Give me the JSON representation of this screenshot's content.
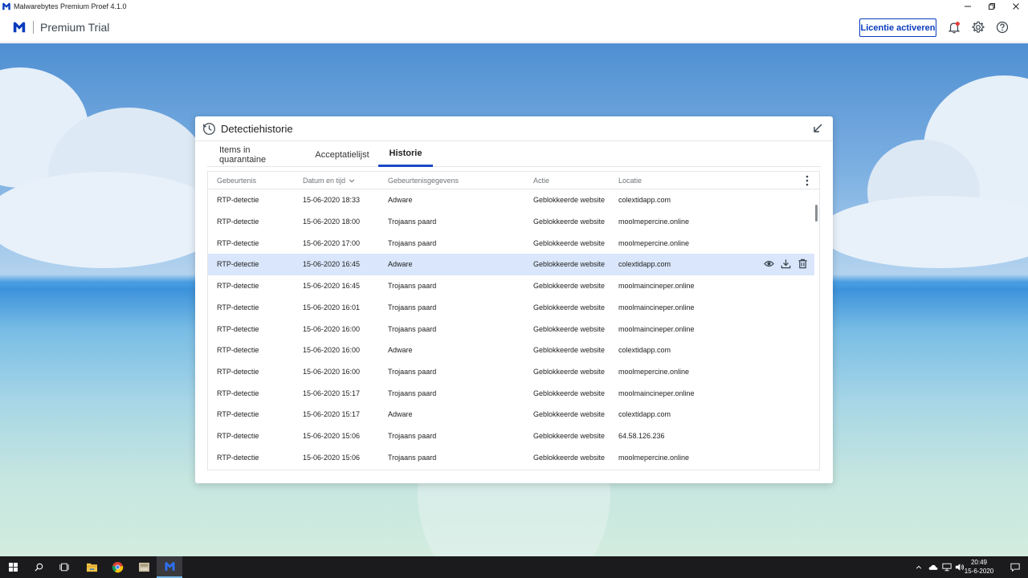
{
  "window": {
    "title": "Malwarebytes Premium Proef  4.1.0",
    "controls": [
      "minimize-icon",
      "restore-icon",
      "close-icon"
    ]
  },
  "header": {
    "product": "Premium Trial",
    "activate_label": "Licentie activeren",
    "icons": [
      "notification-bell-icon",
      "gear-icon",
      "help-icon"
    ],
    "brand_color": "#0a3cbe",
    "notification_dot_color": "#e53935"
  },
  "dialog": {
    "title": "Detectiehistorie",
    "tabs": [
      {
        "label": "Items in quarantaine",
        "active": false
      },
      {
        "label": "Acceptatielijst",
        "active": false
      },
      {
        "label": "Historie",
        "active": true
      }
    ],
    "columns": [
      "Gebeurtenis",
      "Datum en tijd",
      "Gebeurtenisgegevens",
      "Actie",
      "Locatie"
    ],
    "sort_column": "Datum en tijd",
    "rows": [
      {
        "event": "RTP-detectie",
        "datetime": "15-06-2020 18:33",
        "details": "Adware",
        "action": "Geblokkeerde website",
        "location": "colextidapp.com"
      },
      {
        "event": "RTP-detectie",
        "datetime": "15-06-2020 18:00",
        "details": "Trojaans paard",
        "action": "Geblokkeerde website",
        "location": "moolmepercine.online"
      },
      {
        "event": "RTP-detectie",
        "datetime": "15-06-2020 17:00",
        "details": "Trojaans paard",
        "action": "Geblokkeerde website",
        "location": "moolmepercine.online"
      },
      {
        "event": "RTP-detectie",
        "datetime": "15-06-2020 16:45",
        "details": "Adware",
        "action": "Geblokkeerde website",
        "location": "colextidapp.com",
        "selected": true
      },
      {
        "event": "RTP-detectie",
        "datetime": "15-06-2020 16:45",
        "details": "Trojaans paard",
        "action": "Geblokkeerde website",
        "location": "moolmaincineper.online"
      },
      {
        "event": "RTP-detectie",
        "datetime": "15-06-2020 16:01",
        "details": "Trojaans paard",
        "action": "Geblokkeerde website",
        "location": "moolmaincineper.online"
      },
      {
        "event": "RTP-detectie",
        "datetime": "15-06-2020 16:00",
        "details": "Trojaans paard",
        "action": "Geblokkeerde website",
        "location": "moolmaincineper.online"
      },
      {
        "event": "RTP-detectie",
        "datetime": "15-06-2020 16:00",
        "details": "Adware",
        "action": "Geblokkeerde website",
        "location": "colextidapp.com"
      },
      {
        "event": "RTP-detectie",
        "datetime": "15-06-2020 16:00",
        "details": "Trojaans paard",
        "action": "Geblokkeerde website",
        "location": "moolmepercine.online"
      },
      {
        "event": "RTP-detectie",
        "datetime": "15-06-2020 15:17",
        "details": "Trojaans paard",
        "action": "Geblokkeerde website",
        "location": "moolmaincineper.online"
      },
      {
        "event": "RTP-detectie",
        "datetime": "15-06-2020 15:17",
        "details": "Adware",
        "action": "Geblokkeerde website",
        "location": "colextidapp.com"
      },
      {
        "event": "RTP-detectie",
        "datetime": "15-06-2020 15:06",
        "details": "Trojaans paard",
        "action": "Geblokkeerde website",
        "location": "64.58.126.236"
      },
      {
        "event": "RTP-detectie",
        "datetime": "15-06-2020 15:06",
        "details": "Trojaans paard",
        "action": "Geblokkeerde website",
        "location": "moolmepercine.online"
      }
    ],
    "row_actions": [
      "eye-icon",
      "download-icon",
      "trash-icon"
    ]
  },
  "taskbar": {
    "apps": [
      "file-explorer-icon",
      "chrome-icon",
      "image-app-icon",
      "malwarebytes-icon"
    ],
    "time": "20:49",
    "date": "15-6-2020"
  }
}
